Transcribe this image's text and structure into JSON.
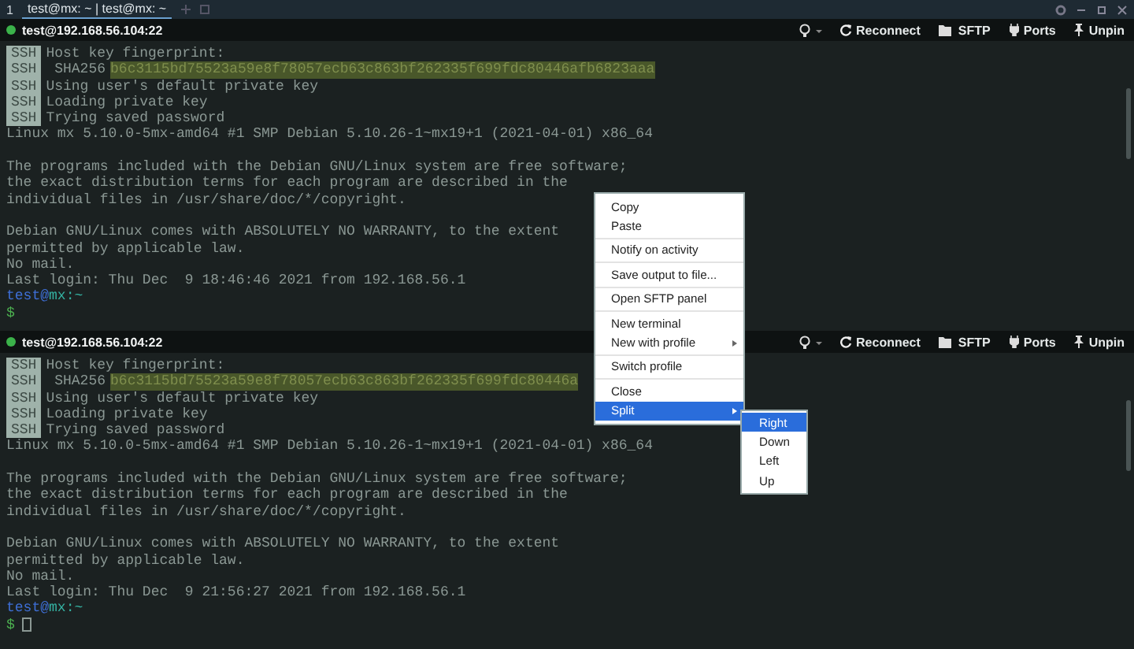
{
  "window": {
    "tab_number": "1",
    "tab_title": "test@mx: ~ | test@mx: ~"
  },
  "panes": [
    {
      "title": "test@192.168.56.104:22",
      "connected": true,
      "toolbar": [
        {
          "kind": "hint"
        },
        {
          "kind": "reconnect",
          "label": "Reconnect"
        },
        {
          "kind": "sftp",
          "label": "SFTP"
        },
        {
          "kind": "ports",
          "label": "Ports"
        },
        {
          "kind": "unpin",
          "label": "Unpin"
        }
      ],
      "lines": [
        {
          "kind": "ssh",
          "badge": "SSH",
          "text": "Host key fingerprint:"
        },
        {
          "kind": "hash",
          "badge": "SSH",
          "label": "SHA256",
          "hash": "b6c3115bd75523a59e8f78057ecb63c863bf262335f699fdc80446afb6823aaa"
        },
        {
          "kind": "ssh",
          "badge": "SSH",
          "text": "Using user's default private key"
        },
        {
          "kind": "ssh",
          "badge": "SSH",
          "text": "Loading private key"
        },
        {
          "kind": "ssh",
          "badge": "SSH",
          "text": "Trying saved password"
        },
        {
          "kind": "text",
          "text": "Linux mx 5.10.0-5mx-amd64 #1 SMP Debian 5.10.26-1~mx19+1 (2021-04-01) x86_64"
        },
        {
          "kind": "blank"
        },
        {
          "kind": "text",
          "text": "The programs included with the Debian GNU/Linux system are free software;"
        },
        {
          "kind": "text",
          "text": "the exact distribution terms for each program are described in the"
        },
        {
          "kind": "text",
          "text": "individual files in /usr/share/doc/*/copyright."
        },
        {
          "kind": "blank"
        },
        {
          "kind": "text",
          "text": "Debian GNU/Linux comes with ABSOLUTELY NO WARRANTY, to the extent"
        },
        {
          "kind": "text",
          "text": "permitted by applicable law."
        },
        {
          "kind": "text",
          "text": "No mail."
        },
        {
          "kind": "text",
          "text": "Last login: Thu Dec  9 18:46:46 2021 from 192.168.56.1"
        },
        {
          "kind": "prompt",
          "user": "test",
          "at": "@",
          "host": "mx",
          "path": ":~"
        },
        {
          "kind": "input",
          "symbol": "$",
          "cursor": false
        }
      ]
    },
    {
      "title": "test@192.168.56.104:22",
      "connected": true,
      "toolbar": [
        {
          "kind": "hint"
        },
        {
          "kind": "reconnect",
          "label": "Reconnect"
        },
        {
          "kind": "sftp",
          "label": "SFTP"
        },
        {
          "kind": "ports",
          "label": "Ports"
        },
        {
          "kind": "unpin",
          "label": "Unpin"
        }
      ],
      "lines": [
        {
          "kind": "ssh",
          "badge": "SSH",
          "text": "Host key fingerprint:"
        },
        {
          "kind": "hash",
          "badge": "SSH",
          "label": "SHA256",
          "hash": "b6c3115bd75523a59e8f78057ecb63c863bf262335f699fdc80446a"
        },
        {
          "kind": "ssh",
          "badge": "SSH",
          "text": "Using user's default private key"
        },
        {
          "kind": "ssh",
          "badge": "SSH",
          "text": "Loading private key"
        },
        {
          "kind": "ssh",
          "badge": "SSH",
          "text": "Trying saved password"
        },
        {
          "kind": "text",
          "text": "Linux mx 5.10.0-5mx-amd64 #1 SMP Debian 5.10.26-1~mx19+1 (2021-04-01) x86_64"
        },
        {
          "kind": "blank"
        },
        {
          "kind": "text",
          "text": "The programs included with the Debian GNU/Linux system are free software;"
        },
        {
          "kind": "text",
          "text": "the exact distribution terms for each program are described in the"
        },
        {
          "kind": "text",
          "text": "individual files in /usr/share/doc/*/copyright."
        },
        {
          "kind": "blank"
        },
        {
          "kind": "text",
          "text": "Debian GNU/Linux comes with ABSOLUTELY NO WARRANTY, to the extent"
        },
        {
          "kind": "text",
          "text": "permitted by applicable law."
        },
        {
          "kind": "text",
          "text": "No mail."
        },
        {
          "kind": "text",
          "text": "Last login: Thu Dec  9 21:56:27 2021 from 192.168.56.1"
        },
        {
          "kind": "prompt",
          "user": "test",
          "at": "@",
          "host": "mx",
          "path": ":~"
        },
        {
          "kind": "input",
          "symbol": "$",
          "cursor": true
        }
      ]
    }
  ],
  "context_menu": {
    "groups": [
      [
        {
          "label": "Copy",
          "has_submenu": false,
          "selected": false
        },
        {
          "label": "Paste",
          "has_submenu": false,
          "selected": false
        }
      ],
      [
        {
          "label": "Notify on activity",
          "has_submenu": false,
          "selected": false
        }
      ],
      [
        {
          "label": "Save output to file...",
          "has_submenu": false,
          "selected": false
        }
      ],
      [
        {
          "label": "Open SFTP panel",
          "has_submenu": false,
          "selected": false
        }
      ],
      [
        {
          "label": "New terminal",
          "has_submenu": false,
          "selected": false
        },
        {
          "label": "New with profile",
          "has_submenu": true,
          "selected": false
        }
      ],
      [
        {
          "label": "Switch profile",
          "has_submenu": false,
          "selected": false
        }
      ],
      [
        {
          "label": "Close",
          "has_submenu": false,
          "selected": false
        },
        {
          "label": "Split",
          "has_submenu": true,
          "selected": true
        }
      ]
    ],
    "submenu": [
      {
        "label": "Right",
        "selected": true
      },
      {
        "label": "Down",
        "selected": false
      },
      {
        "label": "Left",
        "selected": false
      },
      {
        "label": "Up",
        "selected": false
      }
    ]
  }
}
